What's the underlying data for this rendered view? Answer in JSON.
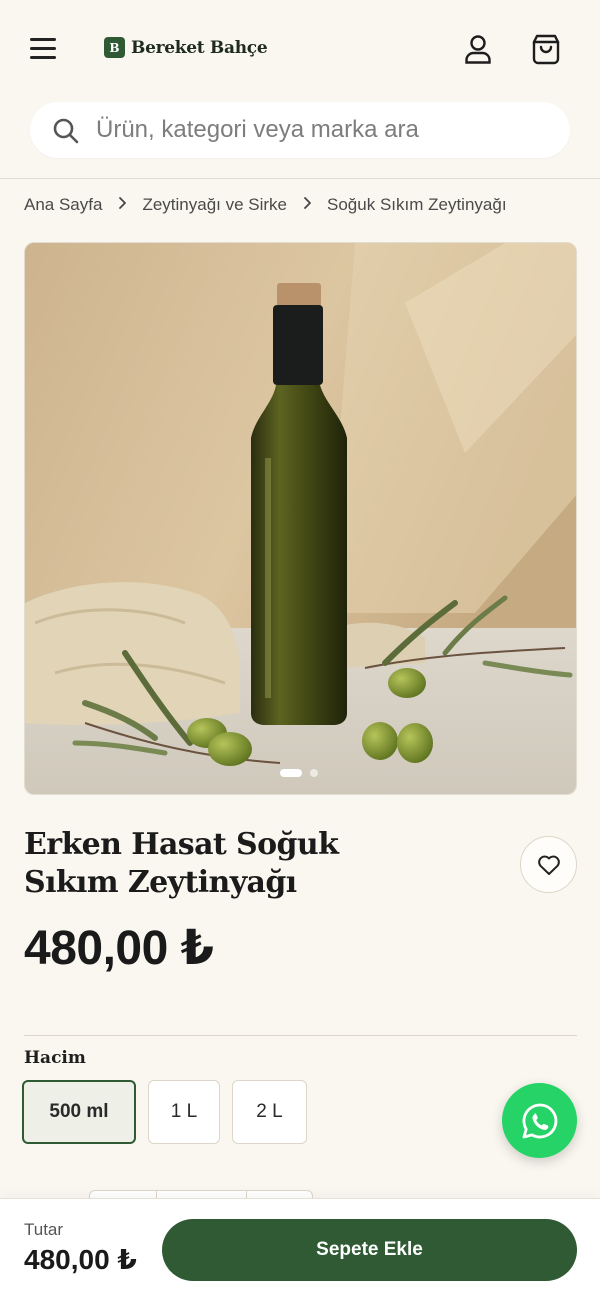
{
  "header": {
    "brand_initial": "B",
    "brand_name": "Bereket Bahçe",
    "menu_icon": "hamburger-icon",
    "user_icon": "user-icon",
    "cart_icon": "shopping-bag-icon"
  },
  "search": {
    "placeholder": "Ürün, kategori veya marka ara",
    "icon": "search-icon"
  },
  "breadcrumb": {
    "items": [
      "Ana Sayfa",
      "Zeytinyağı ve Sirke",
      "Soğuk Sıkım Zeytinyağı"
    ],
    "separator": "›"
  },
  "gallery": {
    "image_description": "olive oil bottle",
    "active_index": 0,
    "slide_count": 2
  },
  "product": {
    "title_line1": "Erken Hasat Soğuk",
    "title_line2": "Sıkım Zeytinyağı",
    "price": "480,00 ₺",
    "favorite_icon": "heart-icon"
  },
  "volume": {
    "label": "Hacim",
    "options": [
      "500 ml",
      "1 L",
      "2 L"
    ],
    "selected": "500 ml"
  },
  "whatsapp": {
    "icon": "whatsapp-icon"
  },
  "footer": {
    "total_label": "Tutar",
    "total_value": "480,00 ₺",
    "add_to_cart": "Sepete Ekle"
  },
  "colors": {
    "brand_green": "#2f5a34",
    "background": "#faf7f0",
    "whatsapp_green": "#25d366"
  }
}
